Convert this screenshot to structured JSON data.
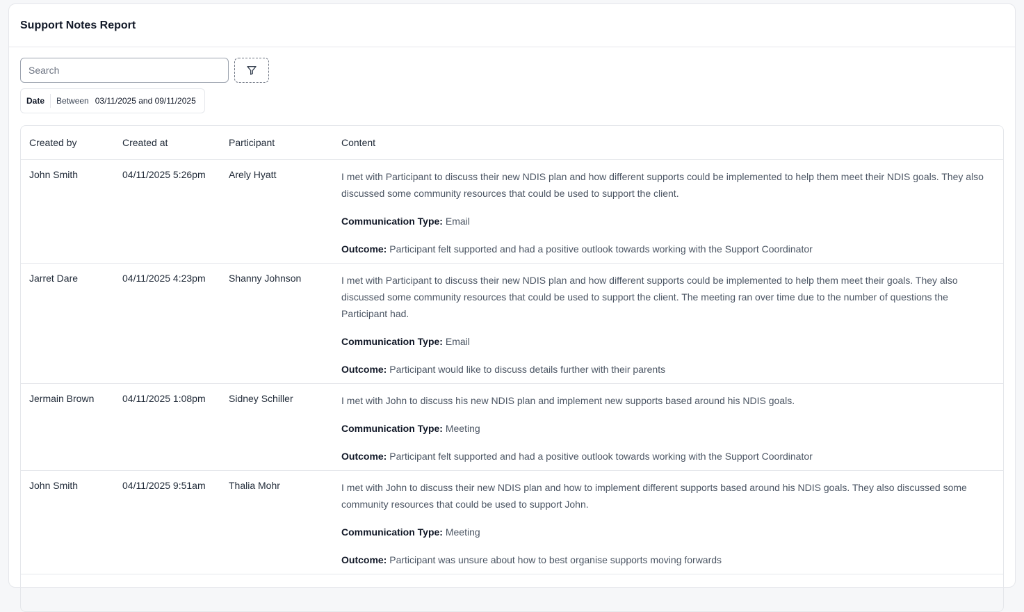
{
  "title": "Support Notes Report",
  "search": {
    "placeholder": "Search",
    "value": ""
  },
  "filter_icon": "filter-icon",
  "date_filter": {
    "key": "Date",
    "operator": "Between",
    "value": "03/11/2025 and 09/11/2025"
  },
  "columns": [
    "Created by",
    "Created at",
    "Participant",
    "Content"
  ],
  "labels": {
    "communication_type": "Communication Type:",
    "outcome": "Outcome:"
  },
  "rows": [
    {
      "created_by": "John Smith",
      "created_at": "04/11/2025 5:26pm",
      "participant": "Arely Hyatt",
      "content": "I met with Participant to discuss their new NDIS plan and how different supports could be implemented to help them meet their NDIS goals. They also discussed some community resources that could be used to support the client.",
      "communication_type": "Email",
      "outcome": "Participant felt supported and had a positive outlook towards working with the Support Coordinator"
    },
    {
      "created_by": "Jarret Dare",
      "created_at": "04/11/2025 4:23pm",
      "participant": "Shanny Johnson",
      "content": "I met with Participant to discuss their new NDIS plan and how different supports could be implemented to help them meet their goals. They also discussed some community resources that could be used to support the client. The meeting ran over time due to the number of questions the Participant had.",
      "communication_type": "Email",
      "outcome": "Participant would like to discuss details further with their parents"
    },
    {
      "created_by": "Jermain Brown",
      "created_at": "04/11/2025 1:08pm",
      "participant": "Sidney Schiller",
      "content": "I met with John to discuss his new NDIS plan and implement new supports based around his NDIS goals.",
      "communication_type": "Meeting",
      "outcome": "Participant felt supported and had a positive outlook towards working with the Support Coordinator"
    },
    {
      "created_by": "John Smith",
      "created_at": "04/11/2025 9:51am",
      "participant": "Thalia Mohr",
      "content": "I met with John to discuss their new NDIS plan and how to implement different supports based around his NDIS goals. They also discussed some community resources that could be used to support John.",
      "communication_type": "Meeting",
      "outcome": "Participant was unsure about how to best organise supports moving forwards"
    }
  ]
}
